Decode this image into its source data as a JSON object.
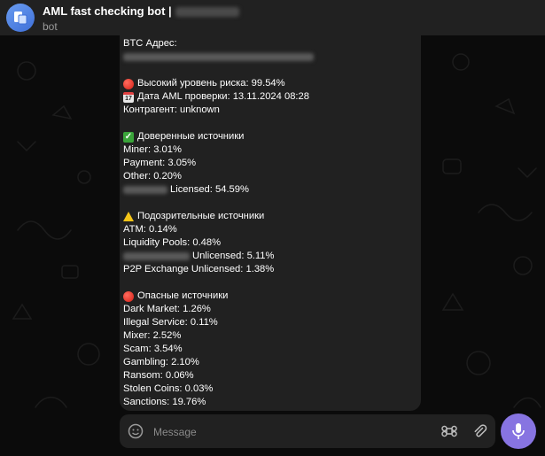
{
  "header": {
    "title": "AML fast checking bot |",
    "subtitle": "bot"
  },
  "message": {
    "lines": [
      {
        "text": "BTC Адрес:"
      },
      {
        "text": ""
      },
      {
        "gap": true
      },
      {
        "emoji": "red-circle",
        "text": "Высокий уровень риска: 99.54%"
      },
      {
        "emoji": "calendar",
        "text": "Дата AML проверки: 13.11.2024 08:28"
      },
      {
        "text": "Контрагент: unknown"
      },
      {
        "gap": true
      },
      {
        "emoji": "check-mark",
        "text": "Доверенные источники"
      },
      {
        "text": "Miner: 3.01%"
      },
      {
        "text": "Payment: 3.05%"
      },
      {
        "text": "Other: 0.20%"
      },
      {
        "text": "Licensed: 54.59%"
      },
      {
        "gap": true
      },
      {
        "emoji": "warning",
        "text": "Подозрительные источники"
      },
      {
        "text": "ATM: 0.14%"
      },
      {
        "text": "Liquidity Pools: 0.48%"
      },
      {
        "text": "Unlicensed: 5.11%"
      },
      {
        "text": "P2P Exchange Unlicensed: 1.38%"
      },
      {
        "gap": true
      },
      {
        "emoji": "red-circle",
        "text": "Опасные источники"
      },
      {
        "text": "Dark Market: 1.26%"
      },
      {
        "text": "Illegal Service: 0.11%"
      },
      {
        "text": "Mixer: 2.52%"
      },
      {
        "text": "Scam: 3.54%"
      },
      {
        "text": "Gambling: 2.10%"
      },
      {
        "text": "Ransom: 0.06%"
      },
      {
        "text": "Stolen Coins: 0.03%"
      },
      {
        "text": "Sanctions: 19.76%"
      }
    ]
  },
  "composer": {
    "placeholder": "Message"
  },
  "colors": {
    "accent": "#8774e1",
    "bubble": "#212121",
    "header": "#212121"
  }
}
